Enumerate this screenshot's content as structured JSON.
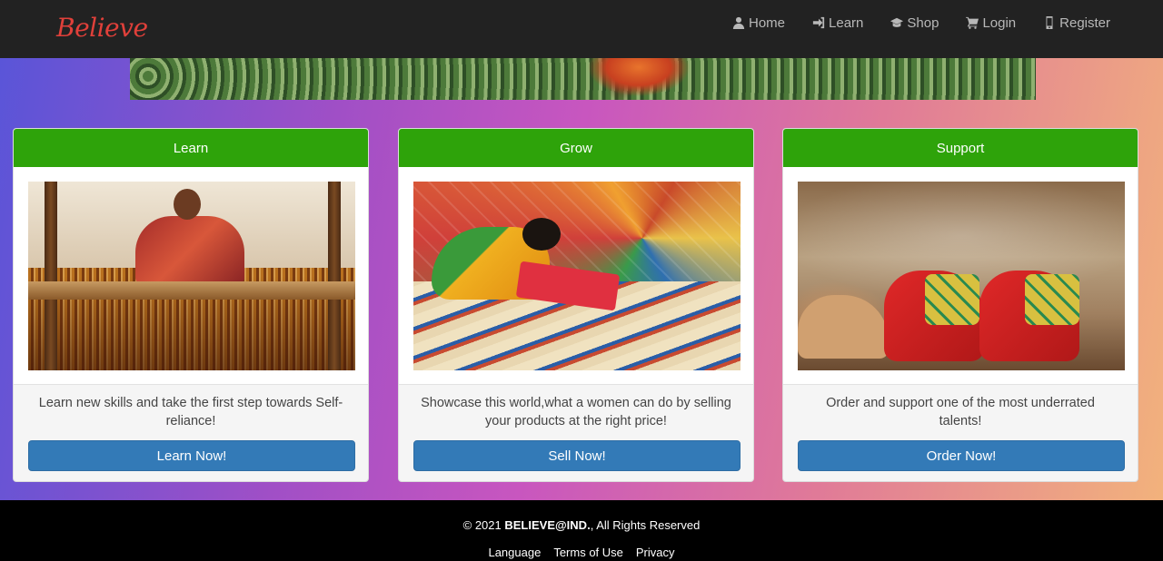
{
  "brand": {
    "name": "Believe",
    "color": "#e0403a"
  },
  "nav": {
    "items": [
      {
        "label": "Home",
        "icon": "user-icon"
      },
      {
        "label": "Learn",
        "icon": "sign-in-icon"
      },
      {
        "label": "Shop",
        "icon": "graduation-cap-icon"
      },
      {
        "label": "Login",
        "icon": "shopping-cart-icon"
      },
      {
        "label": "Register",
        "icon": "mobile-phone-icon"
      }
    ]
  },
  "cards": [
    {
      "title": "Learn",
      "text": "Learn new skills and take the first step towards Self-reliance!",
      "button": "Learn Now!"
    },
    {
      "title": "Grow",
      "text": "Showcase this world,what a women can do by selling your products at the right price!",
      "button": "Sell Now!"
    },
    {
      "title": "Support",
      "text": "Order and support one of the most underrated talents!",
      "button": "Order Now!"
    }
  ],
  "footer": {
    "copyright_prefix": "© 2021 ",
    "copyright_brand": "BELIEVE@IND.",
    "copyright_suffix": ", All Rights Reserved",
    "links": [
      "Language",
      "Terms of Use",
      "Privacy"
    ]
  },
  "colors": {
    "card_header": "#2ea30a",
    "button": "#337ab7",
    "navbar": "#222222"
  }
}
